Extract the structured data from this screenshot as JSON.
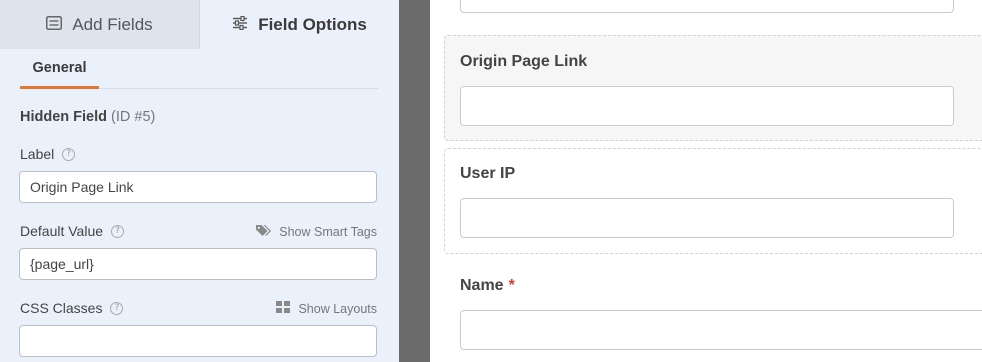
{
  "left_panel": {
    "tabs": [
      {
        "label": "Add Fields",
        "icon": "list-icon"
      },
      {
        "label": "Field Options",
        "icon": "sliders-icon"
      }
    ],
    "sub_tab": "General",
    "field_title": "Hidden Field",
    "field_id": "(ID #5)",
    "label_field": {
      "label": "Label",
      "value": "Origin Page Link"
    },
    "default_value_field": {
      "label": "Default Value",
      "value": "{page_url}",
      "link": "Show Smart Tags",
      "link_icon": "tag-icon"
    },
    "css_classes_field": {
      "label": "CSS Classes",
      "value": "",
      "link": "Show Layouts",
      "link_icon": "layout-grid-icon"
    },
    "help_glyph": "?"
  },
  "preview": {
    "fields": [
      {
        "label": "Origin Page Link",
        "required": false
      },
      {
        "label": "User IP",
        "required": false
      },
      {
        "label": "Name",
        "required": true
      }
    ],
    "required_marker": "*"
  },
  "colors": {
    "accent": "#e27730",
    "panel_bg": "#eaf1fb",
    "divider": "#6b6b6b",
    "required": "#d63638"
  }
}
